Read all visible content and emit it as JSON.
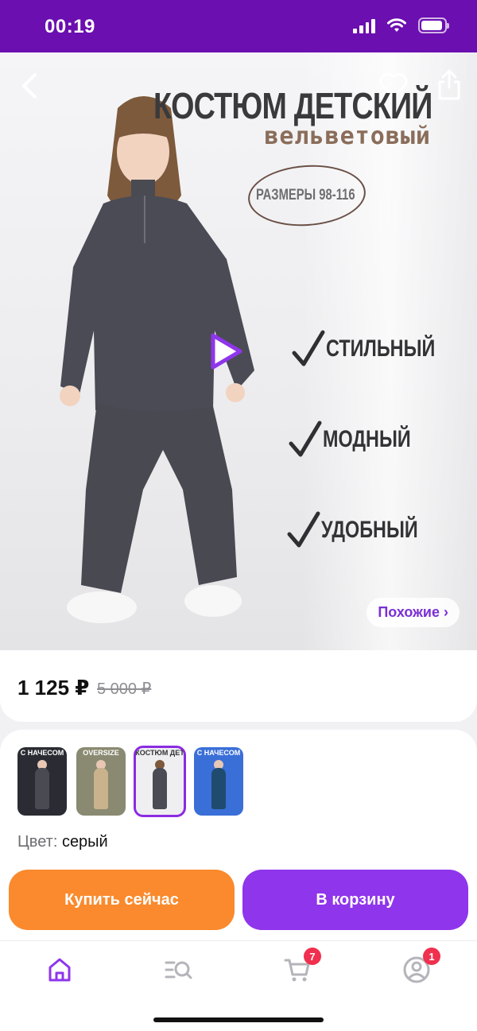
{
  "status_bar": {
    "time": "00:19"
  },
  "promo": {
    "title": "КОСТЮМ ДЕТСКИЙ",
    "subtitle": "вельветовый",
    "sizes": "РАЗМЕРЫ 98-116",
    "features": [
      "СТИЛЬНЫЙ",
      "МОДНЫЙ",
      "УДОБНЫЙ"
    ]
  },
  "hero": {
    "similar_label": "Похожие ›"
  },
  "price": {
    "current": "1 125 ₽",
    "old": "5 000 ₽"
  },
  "variants": {
    "thumbnails": [
      {
        "label": "С НАЧЕСОМ",
        "bg": "#2b2b33",
        "selected": false
      },
      {
        "label": "OVERSIZE",
        "bg": "#8a8a72",
        "selected": false
      },
      {
        "label": "КОСТЮМ ДЕТ",
        "bg": "#efeff1",
        "selected": true
      },
      {
        "label": "С НАЧЕСОМ",
        "bg": "#3a6fd8",
        "selected": false
      }
    ],
    "color_label": "Цвет:",
    "color_value": "серый"
  },
  "actions": {
    "buy_now": "Купить сейчас",
    "add_to_cart": "В корзину"
  },
  "bottom_nav": {
    "cart_badge": "7",
    "profile_badge": "1"
  },
  "colors": {
    "status_bar": "#6b0fb0",
    "accent_purple": "#8f35ec",
    "accent_orange": "#fa8a2d",
    "badge_red": "#f0304e"
  }
}
